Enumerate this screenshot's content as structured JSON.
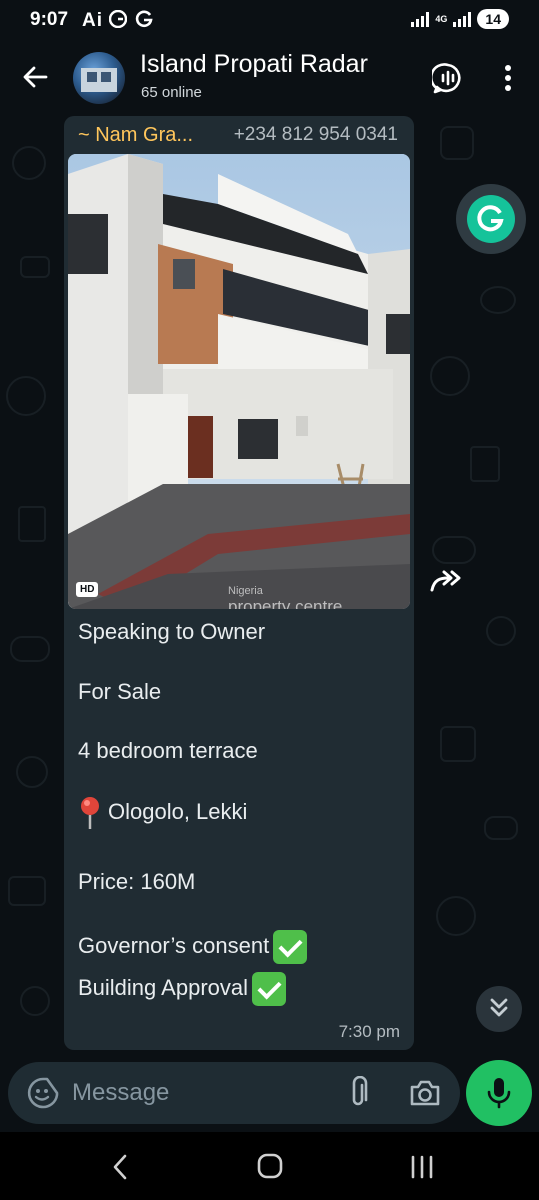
{
  "status_bar": {
    "time": "9:07",
    "extra_indicators": "Ai",
    "network_label": "4G",
    "battery": "14"
  },
  "header": {
    "title": "Island Propati Radar",
    "subtitle": "65 online"
  },
  "message": {
    "sender_name": "~ Nam Gra...",
    "sender_phone": "+234 812 954 0341",
    "image_badge": "HD",
    "watermark_line1": "Nigeria",
    "watermark_line2": "property centre",
    "lines": {
      "l1": "Speaking to Owner",
      "l2": "For Sale",
      "l3": "4 bedroom terrace",
      "l4": "Ologolo, Lekki",
      "l5": "Price: 160M",
      "l6": "Governor’s consent",
      "l7": "Building Approval"
    },
    "time": "7:30 pm"
  },
  "composer": {
    "placeholder": "Message"
  },
  "colors": {
    "accent_green": "#21c063",
    "sender_name": "#ffc65c",
    "bubble": "#202c33"
  },
  "icons": {
    "back": "arrow-left-icon",
    "call": "group-call-icon",
    "menu": "more-vertical-icon",
    "grammarly": "grammarly-icon",
    "forward": "forward-icon",
    "scroll": "chevron-double-down-icon",
    "emoji": "sticker-icon",
    "attach": "paperclip-icon",
    "camera": "camera-icon",
    "mic": "microphone-icon"
  }
}
